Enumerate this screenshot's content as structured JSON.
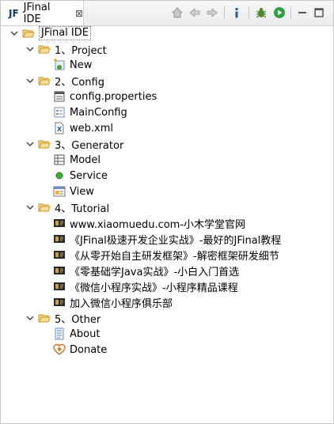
{
  "tab": {
    "icon_text": "JF",
    "title": "JFinal IDE",
    "close": "⊠"
  },
  "toolbar": {
    "icons": [
      "home-icon",
      "back-arrow-icon",
      "forward-arrow-icon",
      "info-icon",
      "debug-bug-icon",
      "run-icon",
      "minimize-icon",
      "maximize-icon"
    ]
  },
  "tree": {
    "root": "JFinal IDE",
    "groups": [
      {
        "label": "1、Project",
        "items": [
          "New"
        ]
      },
      {
        "label": "2、Config",
        "items": [
          "config.properties",
          "MainConfig",
          "web.xml"
        ]
      },
      {
        "label": "3、Generator",
        "items": [
          "Model",
          "Service",
          "View"
        ]
      },
      {
        "label": "4、Tutorial",
        "items": [
          "www.xiaomuedu.com-小木学堂官网",
          "《JFinal极速开发企业实战》-最好的JFinal教程",
          "《从零开始自主研发框架》-解密框架研发细节",
          "《零基础学Java实战》-小白入门首选",
          "《微信小程序实战》-小程序精品课程",
          "加入微信小程序俱乐部"
        ]
      },
      {
        "label": "5、Other",
        "items": [
          "About",
          "Donate"
        ]
      }
    ]
  },
  "colors": {
    "folder": "#e8b64a",
    "accent": "#1e5fa8",
    "run_green": "#2ea043"
  }
}
